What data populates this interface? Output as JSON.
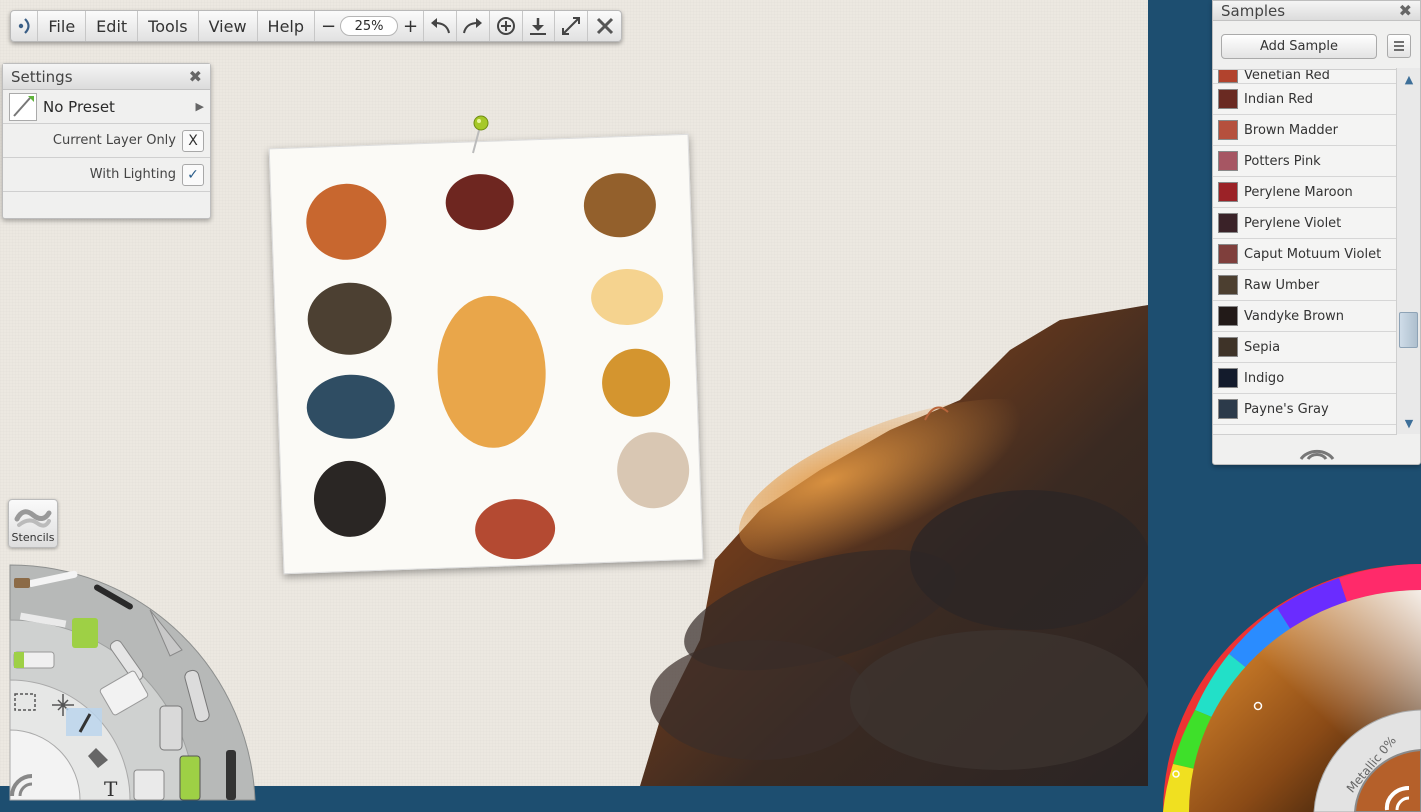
{
  "toolbar": {
    "menus": [
      "File",
      "Edit",
      "Tools",
      "View",
      "Help"
    ],
    "zoom_minus": "−",
    "zoom_value": "25%",
    "zoom_plus": "+"
  },
  "settings": {
    "title": "Settings",
    "preset_label": "No Preset",
    "current_layer_only_label": "Current Layer Only",
    "current_layer_only_value": "X",
    "with_lighting_label": "With Lighting",
    "with_lighting_value": "✓"
  },
  "stencils": {
    "label": "Stencils"
  },
  "samples": {
    "title": "Samples",
    "add_button": "Add Sample",
    "items": [
      {
        "name": "Venetian Red",
        "color": "#b2432d"
      },
      {
        "name": "Indian Red",
        "color": "#6a2a22"
      },
      {
        "name": "Brown Madder",
        "color": "#b5503d"
      },
      {
        "name": "Potters Pink",
        "color": "#a65663"
      },
      {
        "name": "Perylene Maroon",
        "color": "#9b2227"
      },
      {
        "name": "Perylene Violet",
        "color": "#3a2228"
      },
      {
        "name": "Caput Motuum Violet",
        "color": "#7f3f3c"
      },
      {
        "name": "Raw Umber",
        "color": "#4c3f30"
      },
      {
        "name": "Vandyke Brown",
        "color": "#221a18"
      },
      {
        "name": "Sepia",
        "color": "#3e3328"
      },
      {
        "name": "Indigo",
        "color": "#131b2c"
      },
      {
        "name": "Payne's Gray",
        "color": "#2c3a4a"
      }
    ]
  },
  "color_wheel": {
    "metallic_label": "Metallic 0%",
    "current_color": "#b5602a"
  },
  "tools": {
    "text_tool_glyph": "T"
  },
  "reference_swatches": [
    "#c8672f",
    "#6e2620",
    "#93602c",
    "#4c4032",
    "#f5d38f",
    "#e9a64a",
    "#2f4d63",
    "#d4952f",
    "#2a2624",
    "#d9c7b3",
    "#b44a32"
  ]
}
